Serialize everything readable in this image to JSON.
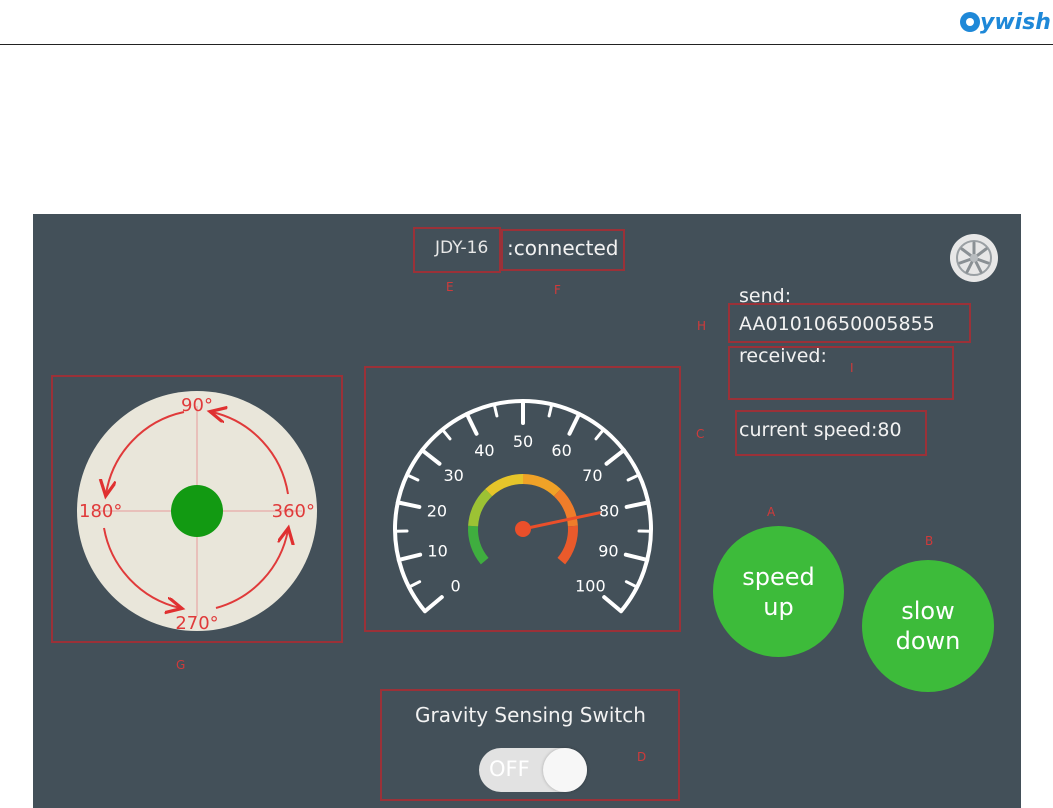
{
  "header": {
    "brand_text": "ywish"
  },
  "device": {
    "name": "JDY-16",
    "status": ":connected"
  },
  "comm": {
    "send_label": "send:",
    "send_value": "AA01010650005855",
    "received_label": "received:"
  },
  "speed": {
    "current_label": "current speed:80",
    "value": 80
  },
  "buttons": {
    "speed_up": [
      "speed",
      "up"
    ],
    "slow_down": [
      "slow",
      "down"
    ]
  },
  "gauge": {
    "min": 0,
    "max": 100,
    "ticks": [
      "0",
      "10",
      "20",
      "30",
      "40",
      "50",
      "60",
      "70",
      "80",
      "90",
      "100"
    ],
    "needle_value": 80
  },
  "direction_pad": {
    "labels": {
      "top": "90°",
      "left": "180°",
      "right": "360°",
      "bottom": "270°"
    }
  },
  "gravity": {
    "title": "Gravity Sensing Switch",
    "toggle_state": "OFF"
  },
  "annotations": {
    "a": "A",
    "b": "B",
    "c": "C",
    "d": "D",
    "e": "E",
    "f": "F",
    "g": "G",
    "h": "H",
    "i": "I"
  },
  "icons": {
    "settings": "settings-wheel-icon",
    "brand": "gear-logo-icon"
  },
  "colors": {
    "panel_bg": "#435059",
    "button_green": "#3dbb3a",
    "annotation_red": "#9b3138",
    "brand_blue": "#1e88d8"
  }
}
